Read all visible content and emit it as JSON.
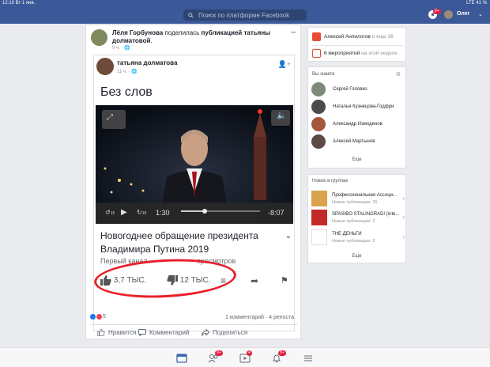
{
  "status_bar": {
    "left": "12:10  Вт 1 янв.",
    "right": "LTE  41 %"
  },
  "top_bar": {
    "search_placeholder": "Поиск по платформе Facebook",
    "notifications_badge": "9+",
    "user_name": "Олег"
  },
  "post": {
    "author": "Лёля Горбунова",
    "action": " поделилась ",
    "target": "публикацией татьяны долматовой",
    "time": "9 ч.",
    "shared": {
      "author": "татьяна долматова",
      "time": "11 ч.",
      "video_heading": "Без слов",
      "video": {
        "time_current": "1:30",
        "time_remaining": "-8:07",
        "skip_back": "15",
        "skip_fwd": "15",
        "progress": 0.3,
        "title": "Новогоднее обращение президента Владимира Путина 2019",
        "channel": "Первый канал",
        "views": "просмотров",
        "likes": "3,7 ТЫС.",
        "dislikes": "12 ТЫС."
      }
    },
    "reaction_count": "5",
    "comments": "1 комментарий",
    "reposts": "4 репоста",
    "like_label": "Нравится",
    "comment_label": "Комментарий",
    "share_label": "Поделиться"
  },
  "right_col": {
    "birthdays": {
      "name": "Алексей Анпилогов",
      "more": "и еще 36"
    },
    "events": {
      "count": "6 мероприятий",
      "suffix": "на этой неделе"
    },
    "contacts": {
      "header": "Вы знаете",
      "items": [
        {
          "name": "Сергей Головко"
        },
        {
          "name": "Наталья Кузнецова-Годфри"
        },
        {
          "name": "Александр Измоденов"
        },
        {
          "name": "Алексей Мартынов"
        }
      ],
      "more": "Еще"
    },
    "groups": {
      "header": "Новое в группах",
      "items": [
        {
          "name": "Профессиональная Ассоци...",
          "sub": "Новые публикации: 25"
        },
        {
          "name": "SPASIBO STALINGRAD! (inte...",
          "sub": "Новые публикации: 2"
        },
        {
          "name": "THE ДЕНЬГИ",
          "sub": "Новые публикации: 2"
        }
      ],
      "more": "Еще"
    }
  },
  "tab_bar": {
    "friends_badge": "9+",
    "video_badge": "4",
    "notif_badge": "9+"
  }
}
